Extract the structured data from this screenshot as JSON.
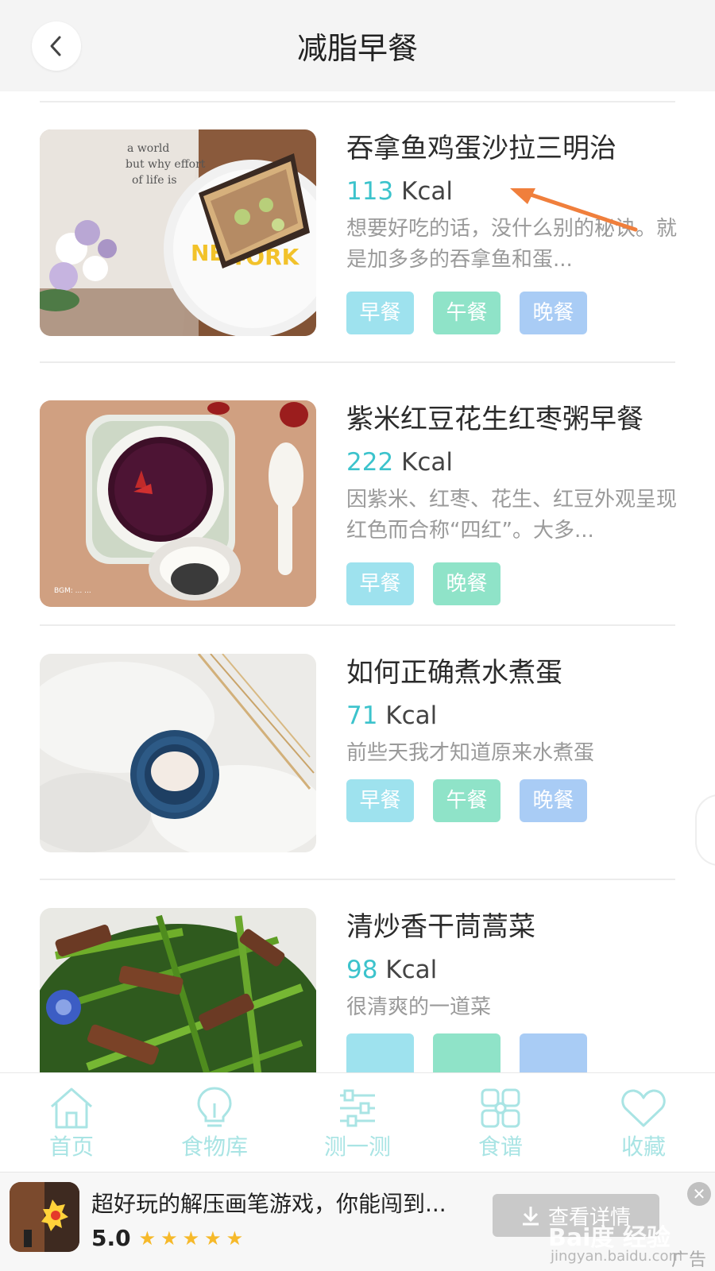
{
  "header": {
    "title": "减脂早餐"
  },
  "recipes": [
    {
      "title": "吞拿鱼鸡蛋沙拉三明治",
      "kcal_value": "113",
      "kcal_unit": " Kcal",
      "description": "想要好吃的话，没什么别的秘诀。就是加多多的吞拿鱼和蛋...",
      "tags": [
        "早餐",
        "午餐",
        "晚餐"
      ]
    },
    {
      "title": "紫米红豆花生红枣粥早餐",
      "kcal_value": "222",
      "kcal_unit": " Kcal",
      "description": "因紫米、红枣、花生、红豆外观呈现红色而合称“四红”。大多...",
      "tags": [
        "早餐",
        "晚餐"
      ]
    },
    {
      "title": "如何正确煮水煮蛋",
      "kcal_value": "71",
      "kcal_unit": " Kcal",
      "description": "前些天我才知道原来水煮蛋",
      "tags": [
        "早餐",
        "午餐",
        "晚餐"
      ]
    },
    {
      "title": "清炒香干茼蒿菜",
      "kcal_value": "98",
      "kcal_unit": " Kcal",
      "description": "很清爽的一道菜",
      "tags": [
        "",
        "",
        ""
      ]
    }
  ],
  "bottom_nav": [
    {
      "label": "首页",
      "icon": "home-icon"
    },
    {
      "label": "食物库",
      "icon": "lightbulb-icon"
    },
    {
      "label": "测一测",
      "icon": "sliders-icon"
    },
    {
      "label": "食谱",
      "icon": "grid-icon"
    },
    {
      "label": "收藏",
      "icon": "heart-icon"
    }
  ],
  "ad": {
    "title": "超好玩的解压画笔游戏，你能闯到...",
    "rating": "5.0",
    "stars": "★★★★★",
    "button_label": "查看详情",
    "close": "✕",
    "label": "广告",
    "watermark": "Bai度 经验",
    "watermark_url": "jingyan.baidu.com"
  },
  "colors": {
    "accent": "#3cc3cc",
    "tag_breakfast": "#9ee2ee",
    "tag_lunch": "#8fe3c8",
    "tag_dinner": "#a9ccf5",
    "arrow": "#f07f3c"
  }
}
